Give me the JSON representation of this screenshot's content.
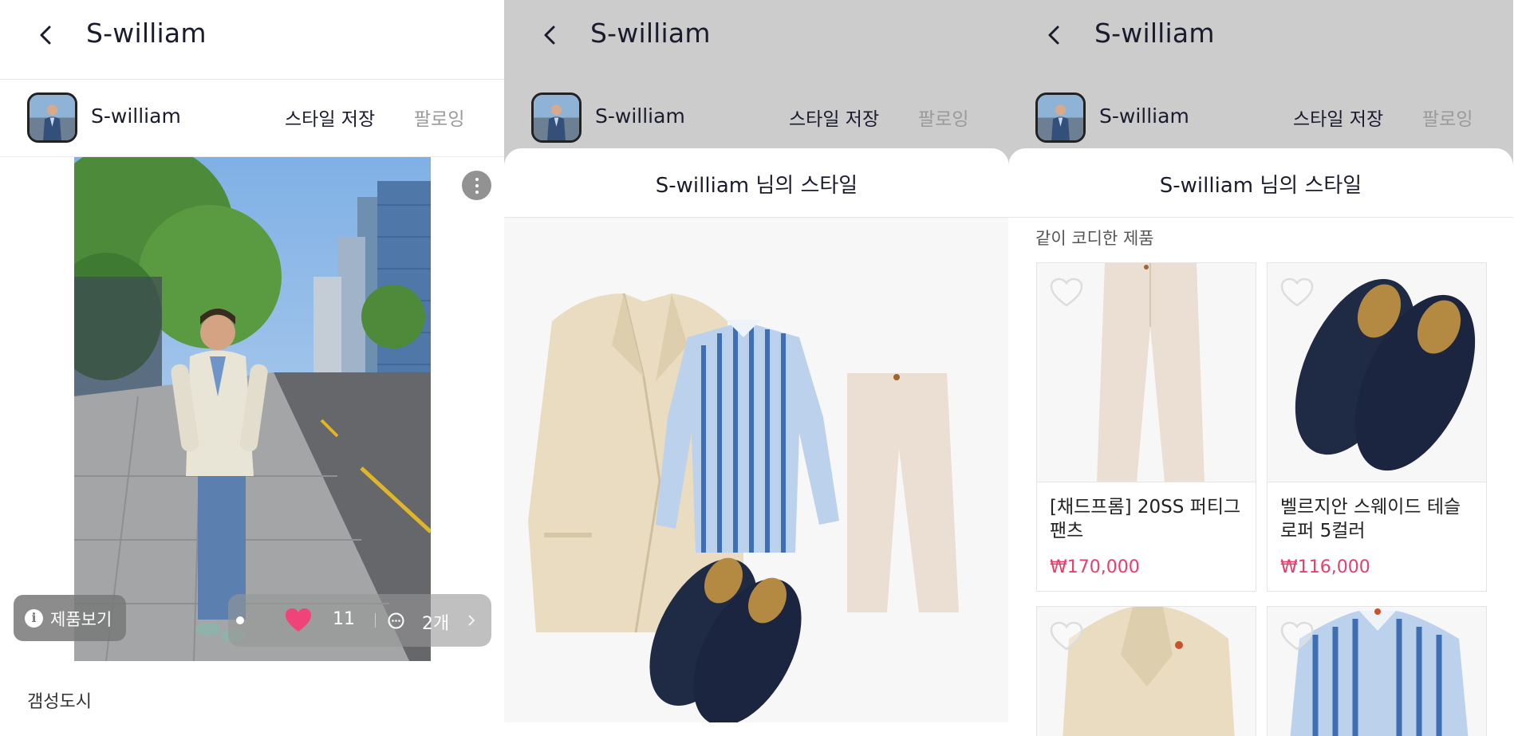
{
  "screen1": {
    "title": "S-william",
    "profile": {
      "name": "S-william",
      "save_style": "스타일 저장",
      "follow": "팔로잉"
    },
    "post": {
      "product_view_label": "제품보기",
      "like_count": "11",
      "comment_count": "2개",
      "caption": "갬성도시"
    }
  },
  "screen2": {
    "title": "S-william",
    "profile": {
      "name": "S-william",
      "save_style": "스타일 저장",
      "follow": "팔로잉"
    },
    "sheet_title": "S-william 님의 스타일"
  },
  "screen3": {
    "title": "S-william",
    "profile": {
      "name": "S-william",
      "save_style": "스타일 저장",
      "follow": "팔로잉"
    },
    "sheet_title": "S-william 님의 스타일",
    "section_label": "같이 코디한 제품",
    "products": [
      {
        "name": "[채드프롬] 20SS 퍼티그 팬츠",
        "price": "₩170,000"
      },
      {
        "name": "벨르지안 스웨이드 테슬 로퍼 5컬러",
        "price": "₩116,000"
      }
    ]
  },
  "colors": {
    "accent_price": "#e83e6c",
    "heart": "#f0437a",
    "overlay": "#cccccc"
  }
}
